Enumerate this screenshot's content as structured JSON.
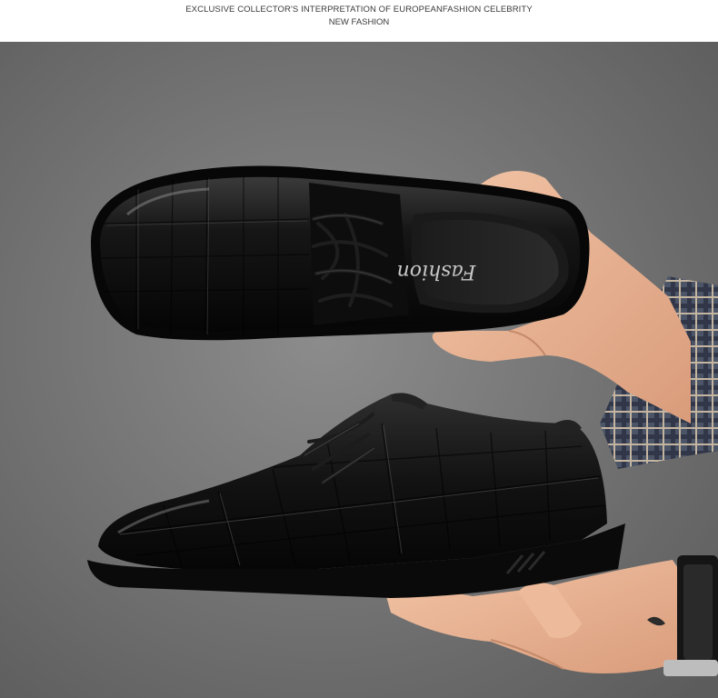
{
  "header": {
    "line1": "EXCLUSIVE COLLECTOR'S INTERPRETATION OF EUROPEANFASHION CELEBRITY",
    "line2": "NEW FASHION"
  },
  "photo": {
    "insole_brand": "Fashion"
  },
  "colors": {
    "background_top": "#6a6a6a",
    "background_bottom": "#8a8a8a",
    "leather": "#111111",
    "skin": "#e9b594",
    "plaid": "#3a4458"
  }
}
